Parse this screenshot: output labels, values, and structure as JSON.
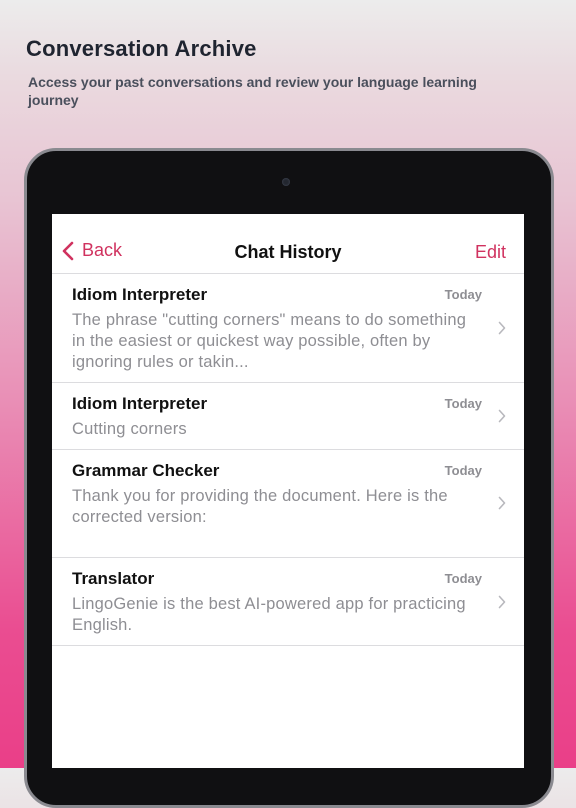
{
  "promo": {
    "title": "Conversation Archive",
    "subtitle": "Access your past conversations and review your language learning journey"
  },
  "navbar": {
    "back_label": "Back",
    "title": "Chat History",
    "edit_label": "Edit"
  },
  "chats": [
    {
      "name": "Idiom Interpreter",
      "date": "Today",
      "preview": "The phrase \"cutting corners\" means to do something in the easiest or quickest way possible, often by ignoring rules or takin..."
    },
    {
      "name": "Idiom Interpreter",
      "date": "Today",
      "preview": "Cutting corners"
    },
    {
      "name": "Grammar Checker",
      "date": "Today",
      "preview": "Thank you for providing the document. Here is the corrected version:"
    },
    {
      "name": "Translator",
      "date": "Today",
      "preview": "LingoGenie is the best AI-powered app for practicing English."
    }
  ],
  "colors": {
    "accent": "#d0325f",
    "muted_text": "#8e8e93",
    "gradient_bottom": "#ea3f88"
  },
  "icons": {
    "back": "chevron-left-icon",
    "row": "chevron-right-icon"
  }
}
